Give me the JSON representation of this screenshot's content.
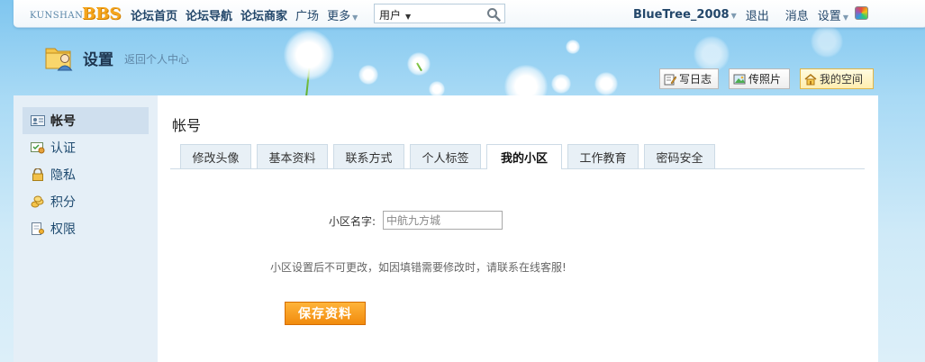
{
  "header": {
    "logo_small": "KUNSHAN",
    "logo_big": "BBS",
    "nav": [
      {
        "label": "论坛首页"
      },
      {
        "label": "论坛导航"
      },
      {
        "label": "论坛商家"
      },
      {
        "label": "广场"
      },
      {
        "label": "更多"
      }
    ],
    "search": {
      "scope": "用户",
      "value": ""
    },
    "user": {
      "username": "BlueTree_2008",
      "logout": "退出",
      "messages": "消息",
      "settings": "设置"
    }
  },
  "banner": {
    "title": "设置",
    "back_link": "返回个人中心",
    "buttons": {
      "write_log": "写日志",
      "upload_photo": "传照片",
      "my_space": "我的空间"
    }
  },
  "sidebar": {
    "items": [
      {
        "label": "帐号",
        "active": true
      },
      {
        "label": "认证"
      },
      {
        "label": "隐私"
      },
      {
        "label": "积分"
      },
      {
        "label": "权限"
      }
    ]
  },
  "main": {
    "title": "帐号",
    "tabs": [
      {
        "label": "修改头像"
      },
      {
        "label": "基本资料"
      },
      {
        "label": "联系方式"
      },
      {
        "label": "个人标签"
      },
      {
        "label": "我的小区",
        "active": true
      },
      {
        "label": "工作教育"
      },
      {
        "label": "密码安全"
      }
    ],
    "form": {
      "community_label": "小区名字:",
      "community_value": "中航九方城",
      "notice": "小区设置后不可更改，如因填错需要修改时，请联系在线客服!",
      "save_label": "保存资料"
    }
  },
  "colors": {
    "accent_orange": "#f18b0d",
    "nav_text": "#23476a",
    "sidebar_bg": "#e5eff7",
    "tab_bg": "#e8f0f6"
  }
}
